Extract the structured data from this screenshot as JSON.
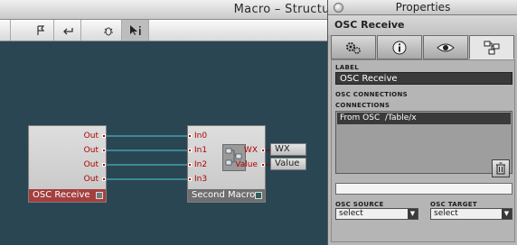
{
  "window": {
    "title": "Macro – Structure"
  },
  "toolbar": {
    "icons": [
      "flag-icon",
      "back-arrow-icon",
      "bug-icon",
      "pointer-info-icon"
    ]
  },
  "canvas": {
    "module_osc": {
      "name": "OSC Receive",
      "outputs": [
        "Out",
        "Out",
        "Out",
        "Out"
      ],
      "footer_color": "#a53f3f"
    },
    "module_macro": {
      "name": "Second Macro",
      "inputs": [
        "In0",
        "In1",
        "In2",
        "In3"
      ],
      "outputs": [
        "WX",
        "Value"
      ],
      "footer_color": "#6f6f6f"
    },
    "outboxes": [
      "WX",
      "Value"
    ],
    "wire_color": "#4fc9d8"
  },
  "properties": {
    "title": "Properties",
    "module_name": "OSC Receive",
    "tabs": [
      "gears-icon",
      "info-icon",
      "eye-icon",
      "structure-icon"
    ],
    "label_heading": "LABEL",
    "label_value": "OSC Receive",
    "osc_connections_heading": "OSC CONNECTIONS",
    "connections_heading": "CONNECTIONS",
    "connections": [
      "From OSC  /Table/x"
    ],
    "osc_source_heading": "OSC SOURCE",
    "osc_target_heading": "OSC TARGET",
    "osc_source_value": "select",
    "osc_target_value": "select"
  }
}
